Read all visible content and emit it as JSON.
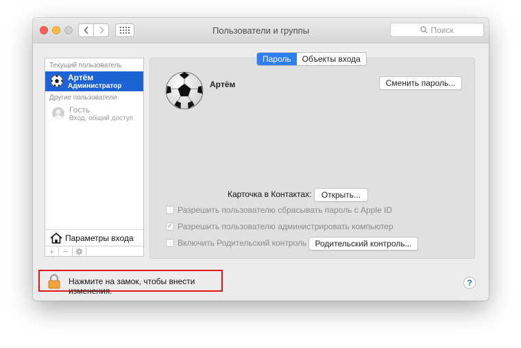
{
  "window": {
    "title": "Пользователи и группы"
  },
  "search": {
    "placeholder": "Поиск"
  },
  "sidebar": {
    "current_label": "Текущий пользователь",
    "current_user": {
      "name": "Артём",
      "role": "Администратор"
    },
    "others_label": "Другие пользователи",
    "guest": {
      "name": "Гость",
      "role": "Вход, общий доступ"
    },
    "login_options": "Параметры входа",
    "toolbar": {
      "add": "+",
      "remove": "−"
    }
  },
  "tabs": [
    {
      "label": "Пароль",
      "active": true
    },
    {
      "label": "Объекты входа",
      "active": false
    }
  ],
  "user": {
    "name": "Артём",
    "change_password": "Сменить пароль..."
  },
  "contacts": {
    "label": "Карточка в Контактах:",
    "open": "Открыть..."
  },
  "options": {
    "reset_appleid": {
      "label": "Разрешить пользователю сбрасывать пароль с Apple ID",
      "checked": false
    },
    "admin": {
      "label": "Разрешить пользователю администрировать компьютер",
      "checked": true
    },
    "parental": {
      "label": "Включить Родительский контроль",
      "checked": false
    },
    "parental_button": "Родительский контроль..."
  },
  "lock": {
    "text": "Нажмите на замок, чтобы внести изменения."
  },
  "help": {
    "label": "?"
  },
  "colors": {
    "selection": "#1d63d6",
    "tab_active": "#2f7ef3",
    "highlight_border": "#e01414",
    "lock": "#f0a340"
  },
  "icons": [
    "back-chevron-icon",
    "forward-chevron-icon",
    "grid-icon",
    "search-icon",
    "soccer-ball-icon",
    "guest-avatar-icon",
    "house-icon",
    "gear-icon",
    "lock-icon",
    "help-icon"
  ]
}
